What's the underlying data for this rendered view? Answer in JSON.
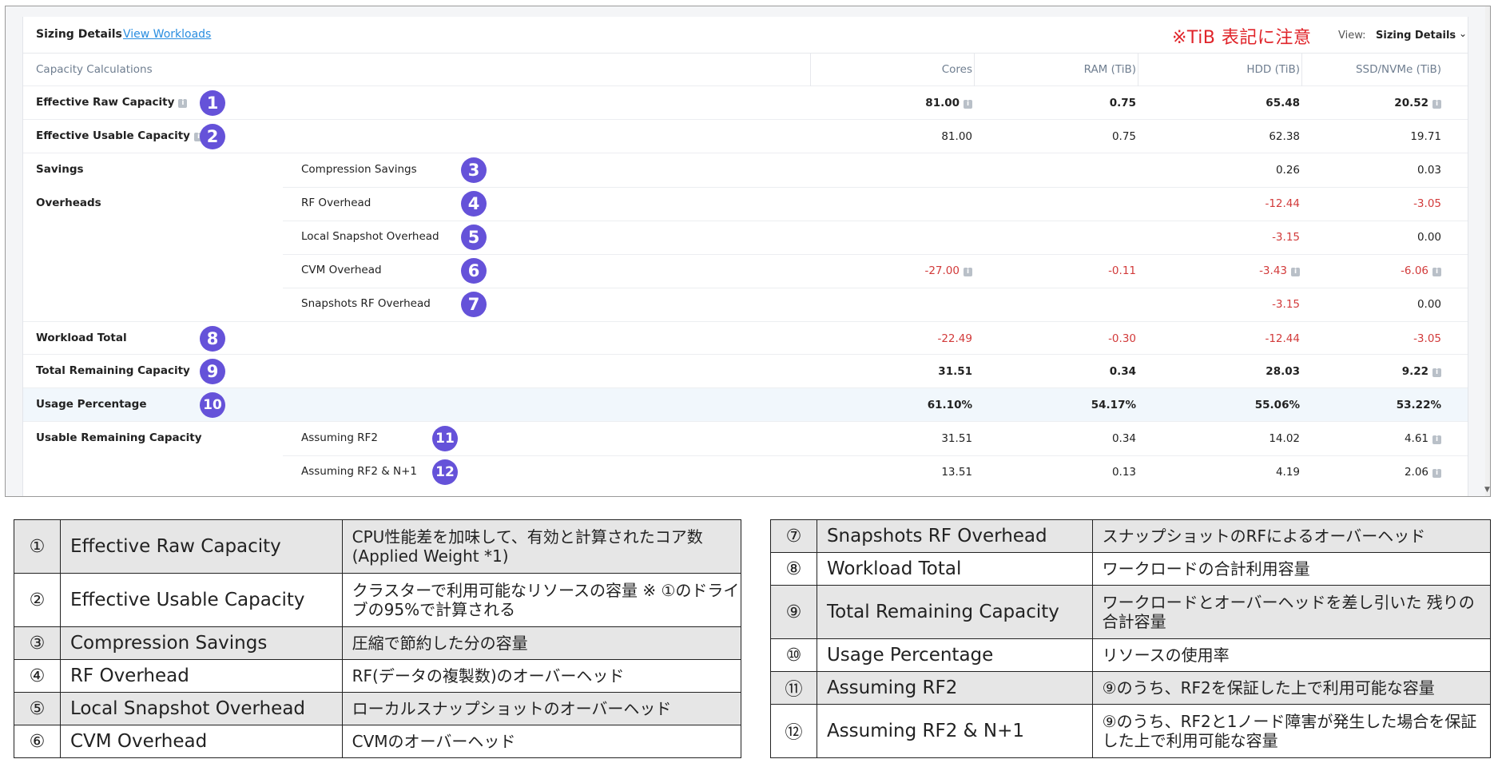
{
  "header": {
    "tabs": [
      "Sizing Details",
      "View Workloads"
    ],
    "note": "※TiB 表記に注意",
    "view_label": "View:",
    "view_value": "Sizing Details",
    "chevron": "⌄"
  },
  "columns": {
    "title": "Capacity Calculations",
    "cores": "Cores",
    "ram": "RAM (TiB)",
    "hdd": "HDD (TiB)",
    "ssd": "SSD/NVMe (TiB)"
  },
  "rows": {
    "raw": {
      "label": "Effective Raw Capacity",
      "badge": "1",
      "cores": "81.00",
      "ram": "0.75",
      "hdd": "65.48",
      "ssd": "20.52"
    },
    "usable": {
      "label": "Effective Usable Capacity",
      "badge": "2",
      "cores": "81.00",
      "ram": "0.75",
      "hdd": "62.38",
      "ssd": "19.71"
    },
    "savings": {
      "label": "Savings"
    },
    "compression": {
      "label": "Compression Savings",
      "badge": "3",
      "hdd": "0.26",
      "ssd": "0.03"
    },
    "overheads": {
      "label": "Overheads"
    },
    "rf": {
      "label": "RF Overhead",
      "badge": "4",
      "hdd": "-12.44",
      "ssd": "-3.05"
    },
    "local_snap": {
      "label": "Local Snapshot Overhead",
      "badge": "5",
      "hdd": "-3.15",
      "ssd": "0.00"
    },
    "cvm": {
      "label": "CVM Overhead",
      "badge": "6",
      "cores": "-27.00",
      "ram": "-0.11",
      "hdd": "-3.43",
      "ssd": "-6.06"
    },
    "snap_rf": {
      "label": "Snapshots RF Overhead",
      "badge": "7",
      "hdd": "-3.15",
      "ssd": "0.00"
    },
    "workload": {
      "label": "Workload Total",
      "badge": "8",
      "cores": "-22.49",
      "ram": "-0.30",
      "hdd": "-12.44",
      "ssd": "-3.05"
    },
    "remaining": {
      "label": "Total Remaining Capacity",
      "badge": "9",
      "cores": "31.51",
      "ram": "0.34",
      "hdd": "28.03",
      "ssd": "9.22"
    },
    "usage": {
      "label": "Usage Percentage",
      "badge": "10",
      "cores": "61.10%",
      "ram": "54.17%",
      "hdd": "55.06%",
      "ssd": "53.22%"
    },
    "usable_remaining": {
      "label": "Usable Remaining Capacity"
    },
    "rf2": {
      "label": "Assuming RF2",
      "badge": "11",
      "cores": "31.51",
      "ram": "0.34",
      "hdd": "14.02",
      "ssd": "4.61"
    },
    "rf2n1": {
      "label": "Assuming RF2 & N+1",
      "badge": "12",
      "cores": "13.51",
      "ram": "0.13",
      "hdd": "4.19",
      "ssd": "2.06"
    }
  },
  "info_glyph": "i",
  "legend_left": [
    {
      "num": "①",
      "name": "Effective Raw Capacity",
      "desc": "CPU性能差を加味して、有効と計算されたコア数 (Applied Weight *1)"
    },
    {
      "num": "②",
      "name": "Effective Usable Capacity",
      "desc": "クラスターで利用可能なリソースの容量 ※ ①のドライブの95%で計算される"
    },
    {
      "num": "③",
      "name": "Compression Savings",
      "desc": "圧縮で節約した分の容量"
    },
    {
      "num": "④",
      "name": "RF Overhead",
      "desc": "RF(データの複製数)のオーバーヘッド"
    },
    {
      "num": "⑤",
      "name": "Local Snapshot Overhead",
      "desc": "ローカルスナップショットのオーバーヘッド"
    },
    {
      "num": "⑥",
      "name": "CVM Overhead",
      "desc": "CVMのオーバーヘッド"
    }
  ],
  "legend_right": [
    {
      "num": "⑦",
      "name": "Snapshots RF Overhead",
      "desc": "スナップショットのRFによるオーバーヘッド"
    },
    {
      "num": "⑧",
      "name": "Workload Total",
      "desc": "ワークロードの合計利用容量"
    },
    {
      "num": "⑨",
      "name": "Total Remaining Capacity",
      "desc": "ワークロードとオーバーヘッドを差し引いた 残りの合計容量"
    },
    {
      "num": "⑩",
      "name": "Usage Percentage",
      "desc": "リソースの使用率"
    },
    {
      "num": "⑪",
      "name": "Assuming RF2",
      "desc": "⑨のうち、RF2を保証した上で利用可能な容量"
    },
    {
      "num": "⑫",
      "name": "Assuming RF2 & N+1",
      "desc": "⑨のうち、RF2と1ノード障害が発生した場合を保証した上で利用可能な容量"
    }
  ]
}
